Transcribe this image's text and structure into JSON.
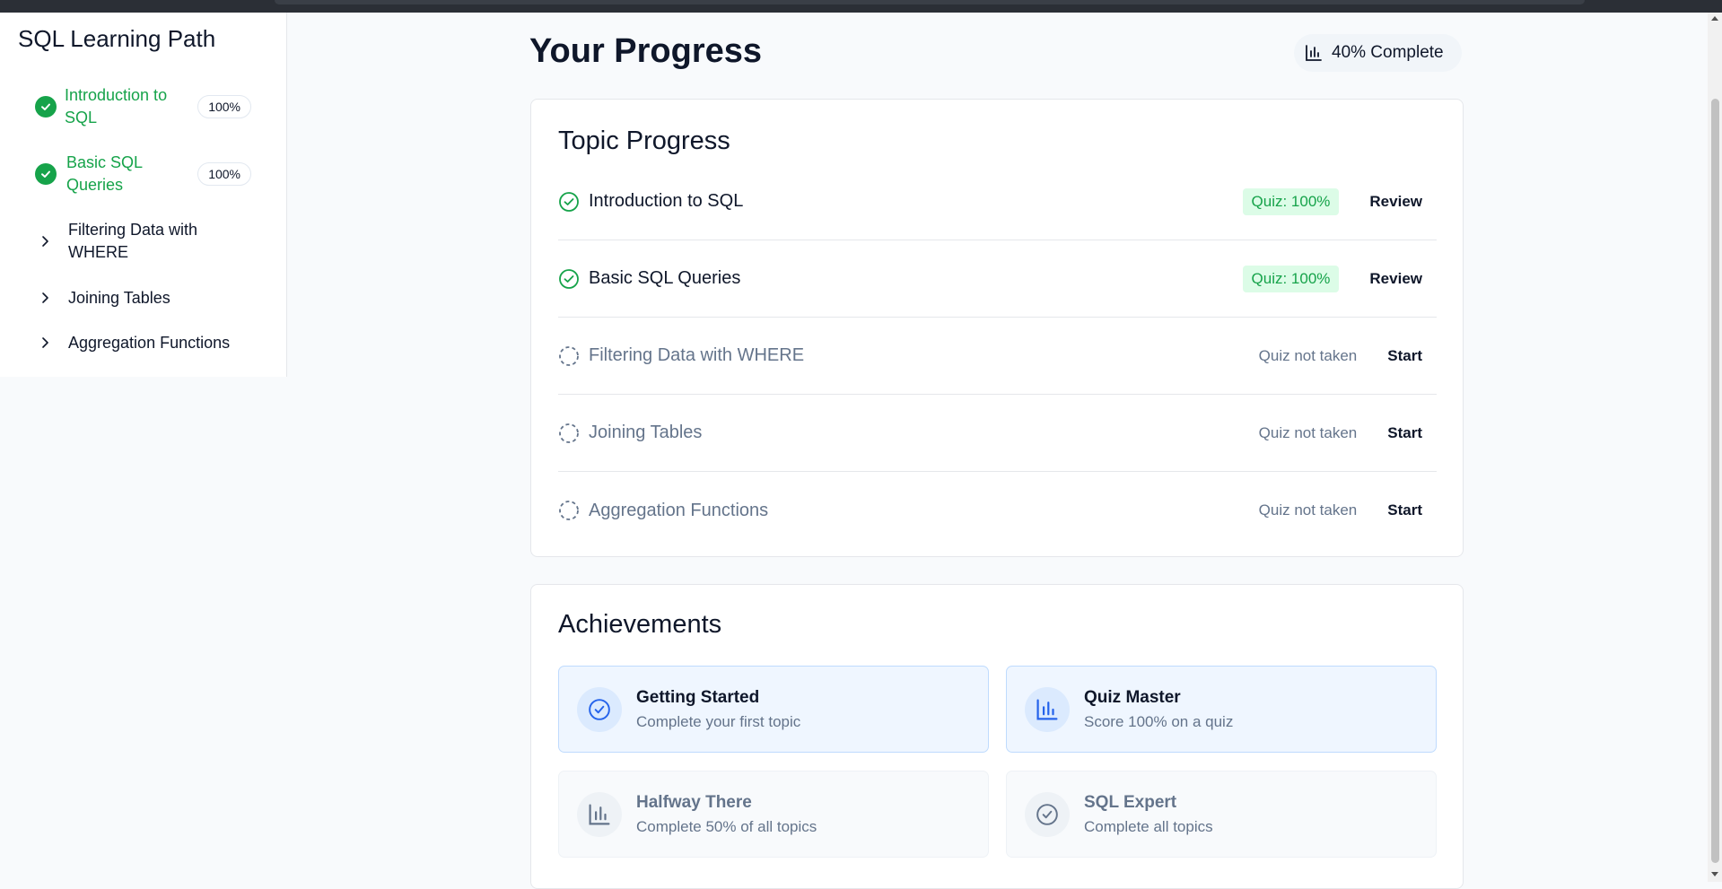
{
  "sidebar": {
    "title": "SQL Learning Path",
    "items": [
      {
        "label": "Introduction to SQL",
        "status": "completed",
        "badge": "100%"
      },
      {
        "label": "Basic SQL Queries",
        "status": "completed",
        "badge": "100%"
      },
      {
        "label": "Filtering Data with WHERE",
        "status": "locked"
      },
      {
        "label": "Joining Tables",
        "status": "locked"
      },
      {
        "label": "Aggregation Functions",
        "status": "locked"
      }
    ]
  },
  "header": {
    "title": "Your Progress",
    "progress_label": "40% Complete",
    "progress_icon": "bar-chart-icon"
  },
  "topic_progress": {
    "title": "Topic Progress",
    "rows": [
      {
        "name": "Introduction to SQL",
        "status": "completed",
        "quiz": "Quiz: 100%",
        "action": "Review"
      },
      {
        "name": "Basic SQL Queries",
        "status": "completed",
        "quiz": "Quiz: 100%",
        "action": "Review"
      },
      {
        "name": "Filtering Data with WHERE",
        "status": "pending",
        "quiz": "Quiz not taken",
        "action": "Start"
      },
      {
        "name": "Joining Tables",
        "status": "pending",
        "quiz": "Quiz not taken",
        "action": "Start"
      },
      {
        "name": "Aggregation Functions",
        "status": "pending",
        "quiz": "Quiz not taken",
        "action": "Start"
      }
    ]
  },
  "achievements": {
    "title": "Achievements",
    "items": [
      {
        "name": "Getting Started",
        "description": "Complete your first topic",
        "unlocked": true,
        "icon": "check-circle-icon"
      },
      {
        "name": "Quiz Master",
        "description": "Score 100% on a quiz",
        "unlocked": true,
        "icon": "bar-chart-icon"
      },
      {
        "name": "Halfway There",
        "description": "Complete 50% of all topics",
        "unlocked": false,
        "icon": "bar-chart-icon"
      },
      {
        "name": "SQL Expert",
        "description": "Complete all topics",
        "unlocked": false,
        "icon": "check-circle-icon"
      }
    ]
  },
  "colors": {
    "success": "#16a34a",
    "success_bg": "#dcfce7",
    "accent": "#2563eb",
    "muted": "#64748b"
  }
}
